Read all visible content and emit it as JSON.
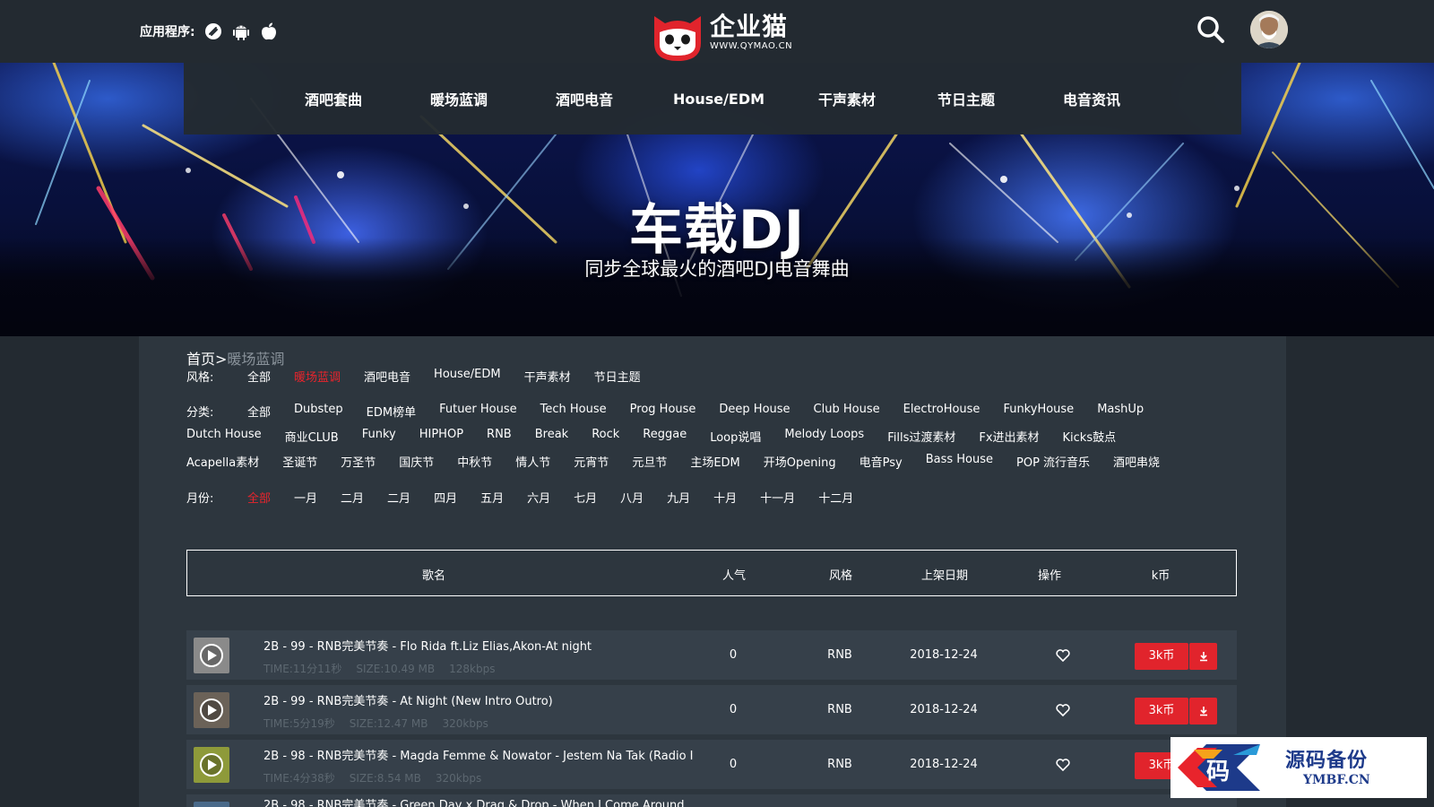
{
  "header": {
    "apps_label": "应用程序:",
    "app_icons": [
      "web-icon",
      "android-icon",
      "apple-icon"
    ],
    "logo_title": "企业猫",
    "logo_sub": "WWW.QYMAO.CN",
    "search_icon": "search-icon",
    "avatar": "user-avatar"
  },
  "nav": {
    "items": [
      "酒吧套曲",
      "暖场蓝调",
      "酒吧电音",
      "House/EDM",
      "干声素材",
      "节日主题",
      "电音资讯"
    ]
  },
  "banner": {
    "title": "车载DJ",
    "subtitle": "同步全球最火的酒吧DJ电音舞曲"
  },
  "breadcrumb": {
    "home": "首页",
    "sep": ">",
    "current": "暖场蓝调"
  },
  "filters": {
    "style": {
      "label": "风格:",
      "options": [
        "全部",
        "暖场蓝调",
        "酒吧电音",
        "House/EDM",
        "干声素材",
        "节日主题"
      ],
      "active": "暖场蓝调"
    },
    "category": {
      "label": "分类:",
      "lines": [
        [
          "全部",
          "Dubstep",
          "EDM榜单",
          "Futuer House",
          "Tech House",
          "Prog House",
          "Deep House",
          "Club House",
          "ElectroHouse",
          "FunkyHouse",
          "MashUp"
        ],
        [
          "Dutch House",
          "商业CLUB",
          "Funky",
          "HIPHOP",
          "RNB",
          "Break",
          "Rock",
          "Reggae",
          "Loop说唱",
          "Melody Loops",
          "Fills过渡素材",
          "Fx进出素材",
          "Kicks鼓点"
        ],
        [
          "Acapella素材",
          "圣诞节",
          "万圣节",
          "国庆节",
          "中秋节",
          "情人节",
          "元宵节",
          "元旦节",
          "主场EDM",
          "开场Opening",
          "电音Psy",
          "Bass House",
          "POP 流行音乐",
          "酒吧串烧"
        ]
      ]
    },
    "month": {
      "label": "月份:",
      "options": [
        "全部",
        "一月",
        "二月",
        "二月",
        "四月",
        "五月",
        "六月",
        "七月",
        "八月",
        "九月",
        "十月",
        "十一月",
        "十二月"
      ],
      "active": "全部"
    }
  },
  "table": {
    "columns": [
      "歌名",
      "人气",
      "风格",
      "上架日期",
      "操作",
      "k币"
    ],
    "rows": [
      {
        "title": "2B - 99 - RNB完美节奏 - Flo Rida ft.Liz Elias,Akon-At night",
        "time": "TIME:11分11秒",
        "size": "SIZE:10.49 MB",
        "bitrate": "128kbps",
        "popularity": "0",
        "style": "RNB",
        "date": "2018-12-24",
        "coin_label": "3k币",
        "thumb_color": "#8a8a8a"
      },
      {
        "title": "2B - 99 - RNB完美节奏 - At Night (New Intro Outro)",
        "time": "TIME:5分19秒",
        "size": "SIZE:12.47 MB",
        "bitrate": "320kbps",
        "popularity": "0",
        "style": "RNB",
        "date": "2018-12-24",
        "coin_label": "3k币",
        "thumb_color": "#6b6258"
      },
      {
        "title": "2B - 98 - RNB完美节奏 - Magda Femme & Nowator - Jestem Na Tak (Radio I",
        "time": "TIME:4分38秒",
        "size": "SIZE:8.54 MB",
        "bitrate": "320kbps",
        "popularity": "0",
        "style": "RNB",
        "date": "2018-12-24",
        "coin_label": "3k币",
        "thumb_color": "#8e9a3a"
      },
      {
        "title": "2B - 98 - RNB完美节奏 - Green Day x Drag & Drop - When I Come Around",
        "time": "",
        "size": "",
        "bitrate": "",
        "popularity": "",
        "style": "",
        "date": "",
        "coin_label": "",
        "thumb_color": "#4a6a8a"
      }
    ]
  },
  "watermark": {
    "logo_char": "码",
    "title": "源码备份",
    "url": "YMBF.CN"
  },
  "colors": {
    "accent": "#e1242c",
    "bg": "#232a31",
    "panel": "#2d363e",
    "row": "#36404a"
  }
}
